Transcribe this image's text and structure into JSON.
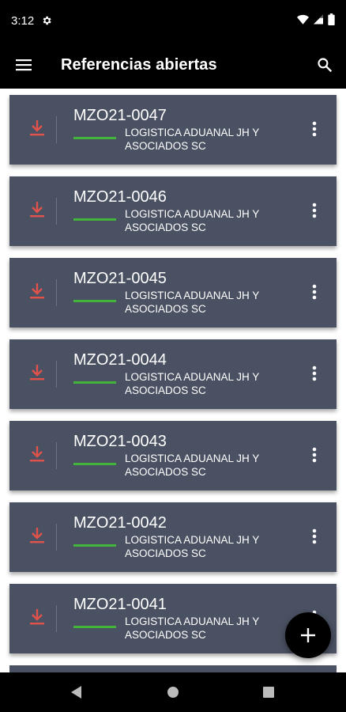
{
  "status_bar": {
    "time": "3:12",
    "icons": [
      "gear-icon",
      "wifi-icon",
      "signal-icon",
      "battery-icon"
    ]
  },
  "app_bar": {
    "title": "Referencias abiertas",
    "left_icon": "hamburger-menu-icon",
    "right_icon": "search-icon"
  },
  "references": [
    {
      "id": "MZO21-0047",
      "company": "LOGISTICA ADUANAL JH Y ASOCIADOS SC"
    },
    {
      "id": "MZO21-0046",
      "company": "LOGISTICA ADUANAL JH Y ASOCIADOS SC"
    },
    {
      "id": "MZO21-0045",
      "company": "LOGISTICA ADUANAL JH Y ASOCIADOS SC"
    },
    {
      "id": "MZO21-0044",
      "company": "LOGISTICA ADUANAL JH Y ASOCIADOS SC"
    },
    {
      "id": "MZO21-0043",
      "company": "LOGISTICA ADUANAL JH Y ASOCIADOS SC"
    },
    {
      "id": "MZO21-0042",
      "company": "LOGISTICA ADUANAL JH Y ASOCIADOS SC"
    },
    {
      "id": "MZO21-0041",
      "company": "LOGISTICA ADUANAL JH Y ASOCIADOS SC"
    }
  ],
  "fab": {
    "icon": "plus-icon"
  },
  "nav_bar": {
    "icons": [
      "back-icon",
      "home-icon",
      "recents-icon"
    ]
  },
  "colors": {
    "card": "#4a5162",
    "download_icon": "#e0524a",
    "status_bar_line": "#43b53b",
    "app_bar": "#000000"
  }
}
